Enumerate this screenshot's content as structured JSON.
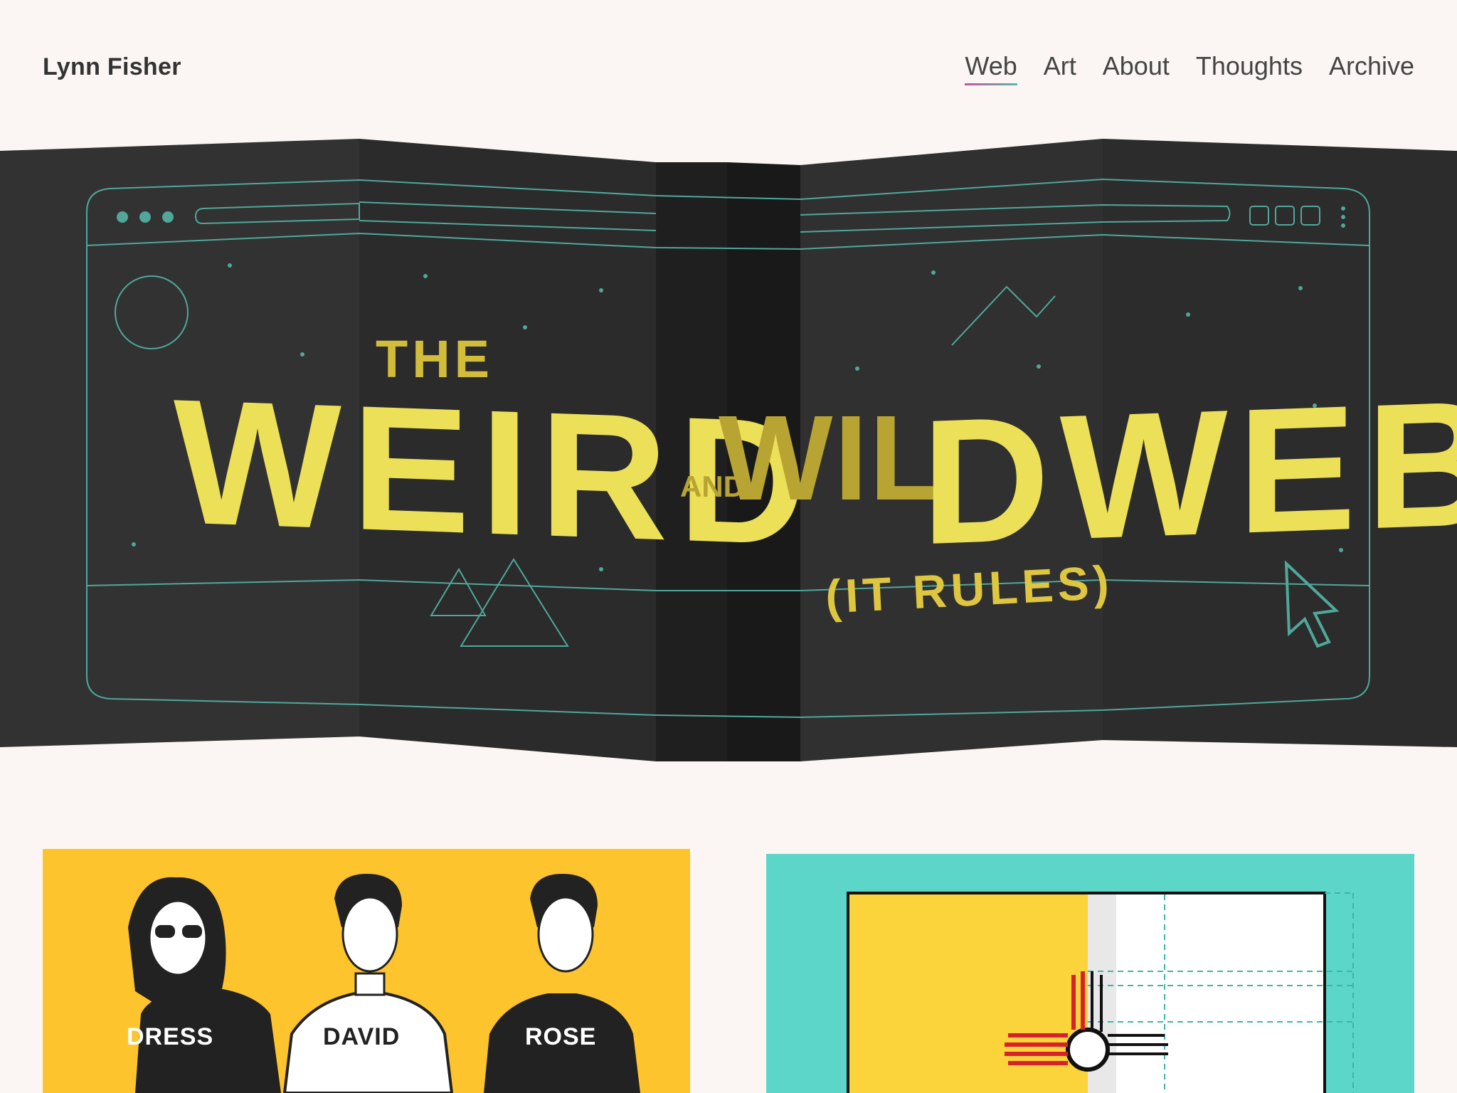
{
  "site": {
    "title": "Lynn Fisher"
  },
  "nav": {
    "items": [
      {
        "label": "Web",
        "active": true
      },
      {
        "label": "Art",
        "active": false
      },
      {
        "label": "About",
        "active": false
      },
      {
        "label": "Thoughts",
        "active": false
      },
      {
        "label": "Archive",
        "active": false
      }
    ]
  },
  "hero": {
    "the": "THE",
    "weird": "WEIRD",
    "and": "AND",
    "wild": "WIL",
    "web": "DWEB",
    "subtitle": "(IT RULES)"
  },
  "cards": {
    "schitts": {
      "labels": [
        "DRESS",
        "DAVID",
        "ROSE"
      ]
    }
  },
  "colors": {
    "background": "#fbf6f3",
    "hero_dark": "#2e2e2e",
    "hero_line": "#4fa89a",
    "title_yellow": "#ece058",
    "card_yellow": "#fec42e",
    "card_teal": "#5bd6c9"
  }
}
